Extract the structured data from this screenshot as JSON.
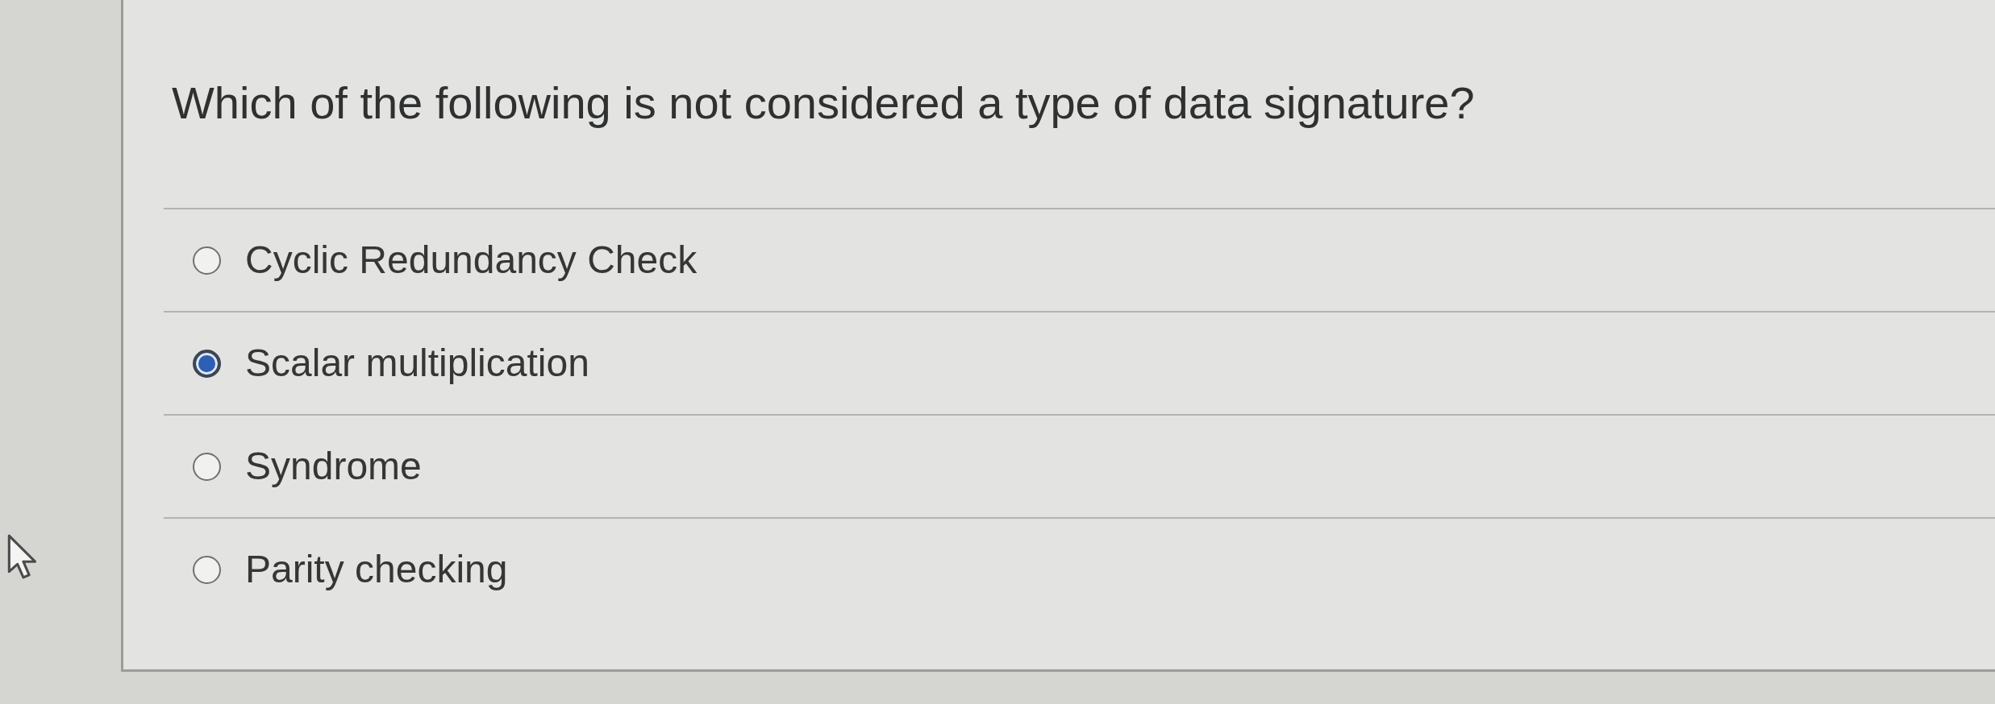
{
  "question": {
    "text": "Which of the following is not considered a type of data signature?"
  },
  "options": [
    {
      "label": "Cyclic Redundancy Check",
      "selected": false
    },
    {
      "label": "Scalar multiplication",
      "selected": true
    },
    {
      "label": "Syndrome",
      "selected": false
    },
    {
      "label": "Parity checking",
      "selected": false
    }
  ]
}
